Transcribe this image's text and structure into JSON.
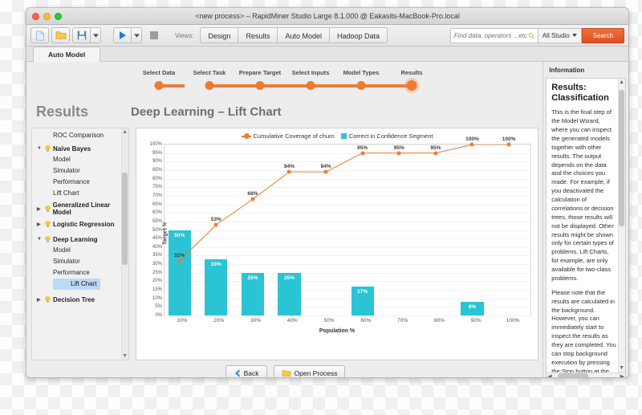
{
  "window": {
    "title": "<new process> – RapidMiner Studio Large 8.1.000 @ Eakasits-MacBook-Pro.local"
  },
  "toolbar": {
    "new_icon": "new-document-icon",
    "open_icon": "open-folder-icon",
    "save_icon": "save-floppy-icon",
    "run_icon": "run-play-icon",
    "stop_icon": "stop-square-icon",
    "views_label": "Views:",
    "view_tabs": [
      "Design",
      "Results",
      "Auto Model",
      "Hadoop Data"
    ],
    "search_placeholder": "Find data, operators ...etc",
    "search_value": "",
    "studio_filter": "All Studio",
    "search_button": "Search"
  },
  "app_tabs": [
    {
      "label": "Auto Model",
      "active": true
    }
  ],
  "wizard": {
    "steps": [
      {
        "label": "Select Data",
        "active": false
      },
      {
        "label": "Select Task",
        "active": false
      },
      {
        "label": "Prepare Target",
        "active": false
      },
      {
        "label": "Select Inputs",
        "active": false
      },
      {
        "label": "Model Types",
        "active": false
      },
      {
        "label": "Results",
        "active": true
      }
    ]
  },
  "headings": {
    "results": "Results",
    "chart_title": "Deep Learning – Lift Chart"
  },
  "tree": {
    "cut_item": "ROC Comparison",
    "groups": [
      {
        "label": "Naive Bayes",
        "expanded": true,
        "children": [
          "Model",
          "Simulator",
          "Performance",
          "Lift Chart"
        ]
      },
      {
        "label": "Generalized Linear Model",
        "expanded": false,
        "children": []
      },
      {
        "label": "Logistic Regression",
        "expanded": false,
        "children": []
      },
      {
        "label": "Deep Learning",
        "expanded": true,
        "children": [
          "Model",
          "Simulator",
          "Performance",
          "Lift Chart"
        ],
        "selected_child": "Lift Chart"
      },
      {
        "label": "Decision Tree",
        "expanded": false,
        "children": []
      }
    ]
  },
  "chart_data": {
    "type": "bar",
    "title": "",
    "xlabel": "Population %",
    "ylabel": "Target %",
    "categories": [
      "10%",
      "20%",
      "30%",
      "40%",
      "50%",
      "60%",
      "70%",
      "80%",
      "90%",
      "100%"
    ],
    "ylim": [
      0,
      100
    ],
    "ytick_labels": [
      "0%",
      "5%",
      "10%",
      "15%",
      "20%",
      "25%",
      "30%",
      "35%",
      "40%",
      "45%",
      "50%",
      "55%",
      "60%",
      "65%",
      "70%",
      "75%",
      "80%",
      "85%",
      "90%",
      "95%",
      "100%"
    ],
    "grid": true,
    "legend_position": "top",
    "legend": [
      "Cumulative Coverage of churn",
      "Correct in Confidence Segment"
    ],
    "series": [
      {
        "name": "Correct in Confidence Segment",
        "kind": "bar",
        "color": "#2bc4d4",
        "values": [
          50,
          33,
          25,
          25,
          0,
          17,
          0,
          0,
          8,
          0
        ],
        "labels": [
          "50%",
          "33%",
          "25%",
          "25%",
          "",
          "17%",
          "",
          "",
          "8%",
          ""
        ]
      },
      {
        "name": "Cumulative Coverage of churn",
        "kind": "line",
        "color": "#f07d34",
        "values": [
          32,
          53,
          68,
          84,
          84,
          95,
          95,
          95,
          100,
          100
        ],
        "labels": [
          "32%",
          "53%",
          "68%",
          "84%",
          "84%",
          "95%",
          "95%",
          "95%",
          "100%",
          "100%"
        ]
      }
    ]
  },
  "bottom_buttons": [
    {
      "label": "Back",
      "icon": "chevron-left-icon"
    },
    {
      "label": "Open Process",
      "icon": "folder-icon"
    }
  ],
  "info": {
    "panel_title": "Information",
    "heading": "Results: Classification",
    "paragraphs": [
      "This is the final step of the Model Wizard, where you can inspect the generated models together with other results. The output depends on the data and the choices you made. For example, if you deactivated the calculation of correlations or decision trees, those results will not be displayed. Other results might be shown only for certain types of problems. Lift Charts, for example, are only available for two-class problems.",
      "Please note that the results are calculated in the background. However, you can immediately start to inspect the results as they are completed. You can stop background execution by pressing the Stop button at the"
    ]
  },
  "colors": {
    "accent_orange": "#f07d34",
    "bar_cyan": "#2bc4d4",
    "search_orange": "#e0501f",
    "selection_blue": "#bcd9f5"
  }
}
